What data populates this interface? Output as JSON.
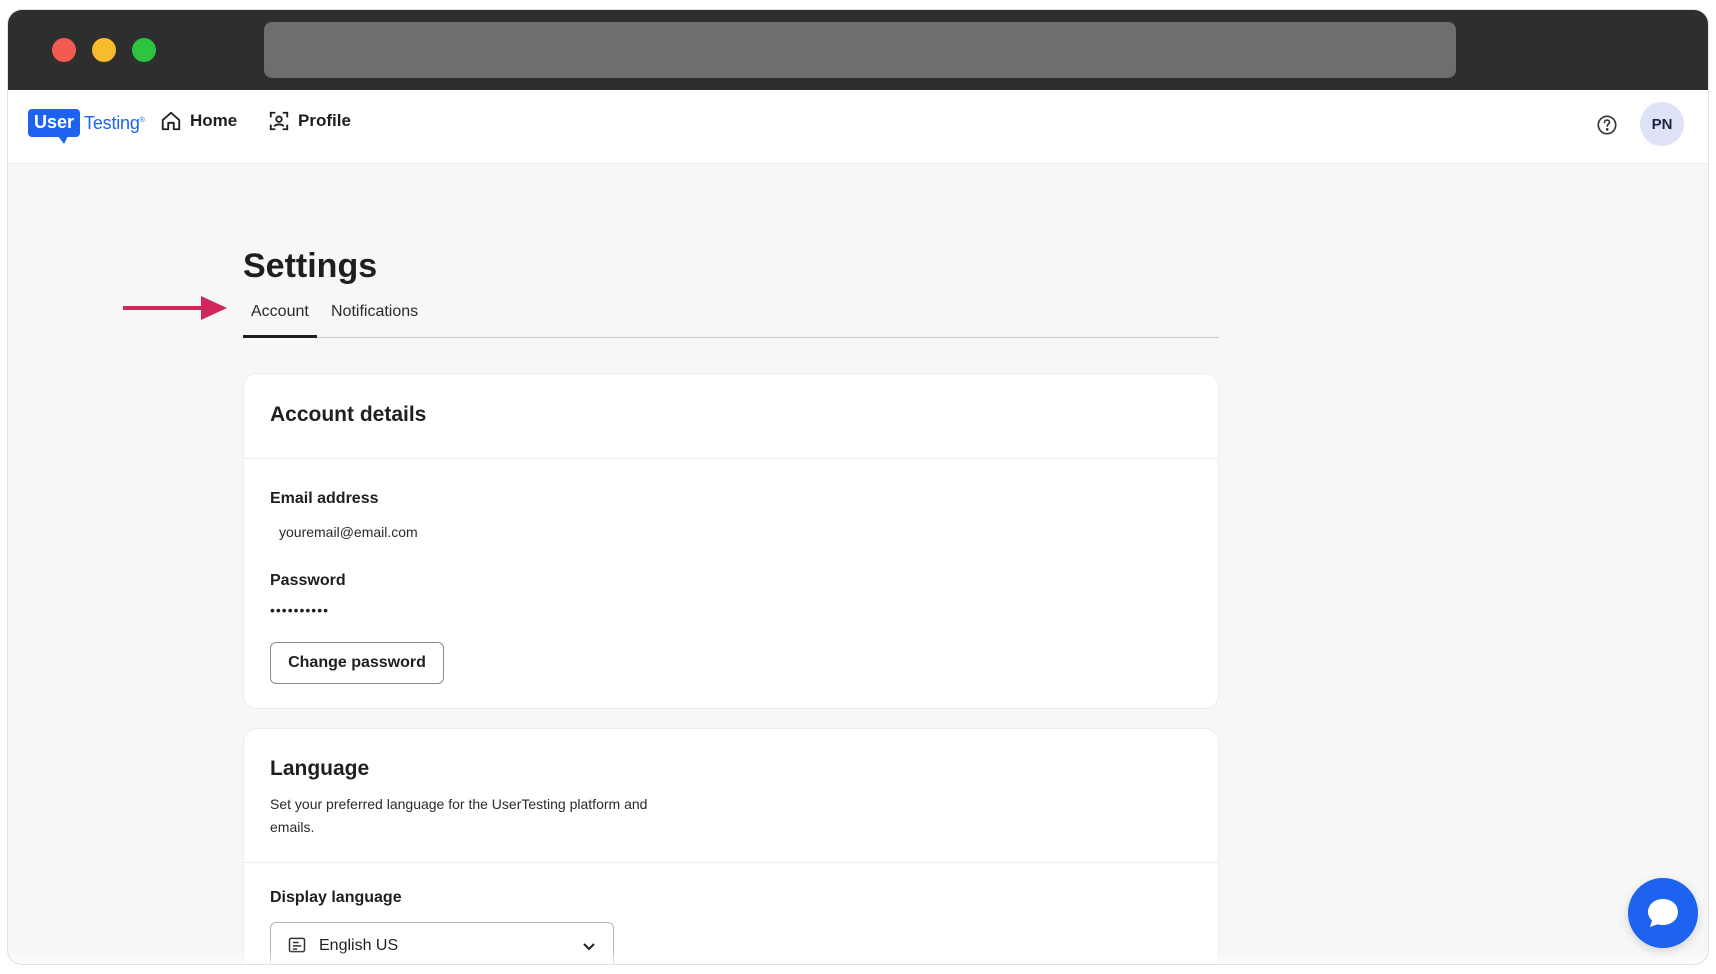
{
  "app": {
    "logo": {
      "user": "User",
      "testing": "Testing",
      "mark": "®"
    },
    "nav": [
      {
        "label": "Home",
        "icon": "home-icon"
      },
      {
        "label": "Profile",
        "icon": "profile-icon"
      }
    ],
    "help_icon": "help-circle-icon",
    "avatar_initials": "PN"
  },
  "page": {
    "title": "Settings",
    "tabs": [
      {
        "label": "Account",
        "active": true
      },
      {
        "label": "Notifications",
        "active": false
      }
    ]
  },
  "account_details": {
    "title": "Account details",
    "email_label": "Email address",
    "email_value": "youremail@email.com",
    "password_label": "Password",
    "password_value": "••••••••••",
    "change_password_label": "Change password"
  },
  "language": {
    "title": "Language",
    "description": "Set your preferred language for the UserTesting platform and emails.",
    "display_label": "Display language",
    "selected": "English US"
  },
  "colors": {
    "brand": "#1e63f0",
    "annotation_arrow": "#d0285a",
    "titlebar": "#2e2e2e"
  }
}
